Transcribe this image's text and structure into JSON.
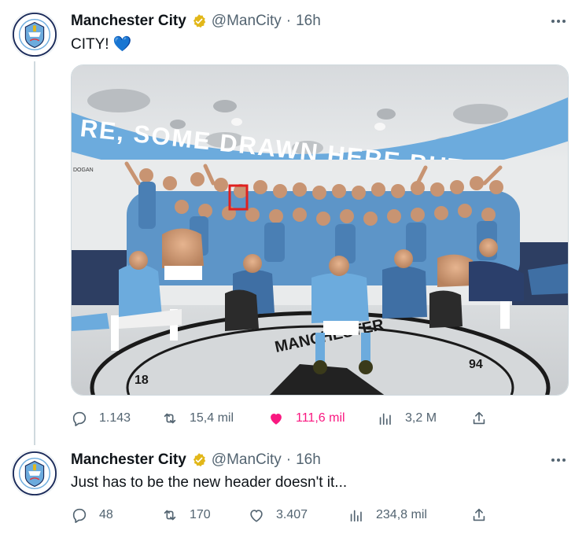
{
  "tweets": [
    {
      "author": "Manchester City",
      "handle": "@ManCity",
      "separator": "·",
      "time": "16h",
      "text": "CITY! 💙",
      "media": {
        "banner_text": "RE, SOME DRAWN HERE BUT WE AL",
        "locker_label_left": "DOGAN",
        "crest_text": "MANCHESTER",
        "crest_year_left": "18",
        "crest_year_right": "94"
      },
      "stats": {
        "replies": "1.143",
        "reposts": "15,4 mil",
        "likes": "111,6 mil",
        "views": "3,2 M"
      },
      "liked": true
    },
    {
      "author": "Manchester City",
      "handle": "@ManCity",
      "separator": "·",
      "time": "16h",
      "text": "Just has to be the new header doesn't it...",
      "stats": {
        "replies": "48",
        "reposts": "170",
        "likes": "3.407",
        "views": "234,8 mil"
      },
      "liked": false
    }
  ],
  "colors": {
    "text_primary": "#0f1419",
    "text_secondary": "#536471",
    "like_active": "#f91880",
    "verified_gold": "#e2b719",
    "city_blue": "#6cabdd",
    "city_navy": "#1c2c5b"
  },
  "icons": [
    "reply-icon",
    "repost-icon",
    "like-icon",
    "views-icon",
    "share-icon",
    "more-icon",
    "verified-badge-icon"
  ]
}
